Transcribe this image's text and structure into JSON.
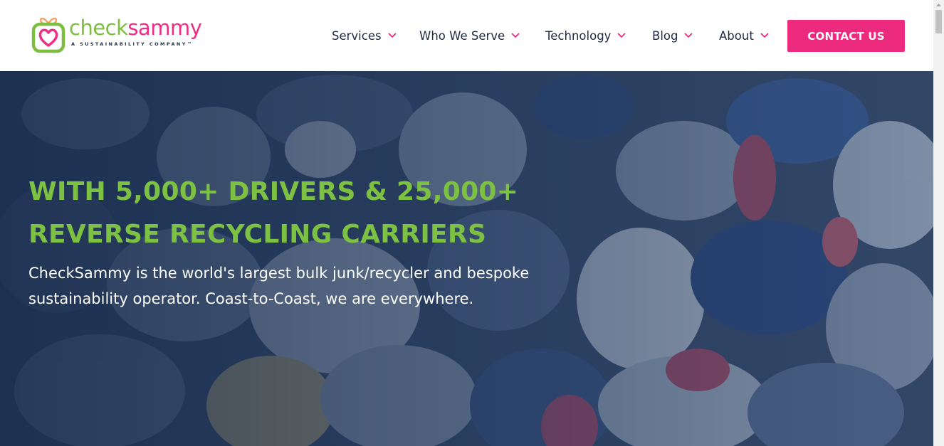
{
  "header": {
    "logo": {
      "word_part1": "check",
      "word_part2": "sammy",
      "tagline": "A SUSTAINABILITY COMPANY™"
    },
    "nav": [
      {
        "label": "Services",
        "icon": "chevron-down-icon"
      },
      {
        "label": "Who We Serve",
        "icon": "chevron-down-icon"
      },
      {
        "label": "Technology",
        "icon": "chevron-down-icon"
      },
      {
        "label": "Blog",
        "icon": "chevron-down-icon"
      },
      {
        "label": "About",
        "icon": "chevron-down-icon"
      }
    ],
    "cta_label": "CONTACT US"
  },
  "hero": {
    "headline_lines": [
      "WITH 5,000+ DRIVERS & 25,000+",
      "REVERSE RECYCLING CARRIERS"
    ],
    "subtext_lines": [
      "CheckSammy is the world's largest bulk junk/recycler and bespoke",
      "sustainability operator. Coast-to-Coast, we are everywhere."
    ],
    "background": "textile-recycling-pile-photo"
  },
  "colors": {
    "brand_green": "#7cbd42",
    "brand_pink": "#ec2b7e",
    "nav_text": "#1f2a44",
    "hero_overlay": "#233a5a"
  }
}
